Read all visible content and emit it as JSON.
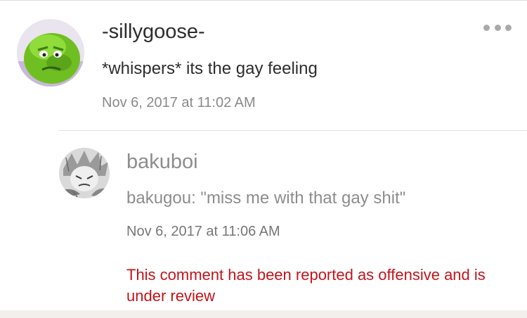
{
  "comment": {
    "username": "-sillygoose-",
    "text": "*whispers* its the gay feeling",
    "timestamp": "Nov 6, 2017 at 11:02 AM",
    "avatar_icon": "green-cartoon-avatar",
    "more_icon": "more-dots-icon"
  },
  "reply": {
    "username": "bakuboi",
    "text": "bakugou: \"miss me with that gay shit\"",
    "timestamp": "Nov 6, 2017 at 11:06 AM",
    "avatar_icon": "manga-avatar",
    "report_notice": "This comment has been reported as offensive and is under review"
  },
  "colors": {
    "text_dark": "#2d2d2d",
    "text_muted": "#8d8d8d",
    "report_red": "#c4131a",
    "avatar_green": "#7fcf2a"
  }
}
